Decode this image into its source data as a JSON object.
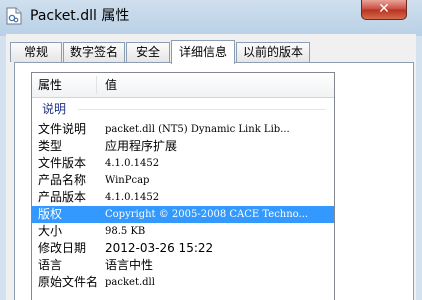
{
  "window": {
    "title": "Packet.dll 属性",
    "close_glyph": "✕"
  },
  "tabs": [
    {
      "label": "常规"
    },
    {
      "label": "数字签名"
    },
    {
      "label": "安全"
    },
    {
      "label": "详细信息",
      "active": true
    },
    {
      "label": "以前的版本"
    }
  ],
  "table": {
    "col_property": "属性",
    "col_value": "值",
    "group": "说明",
    "rows": [
      {
        "k": "文件说明",
        "v": "packet.dll (NT5) Dynamic Link Lib..."
      },
      {
        "k": "类型",
        "v": "应用程序扩展"
      },
      {
        "k": "文件版本",
        "v": "4.1.0.1452"
      },
      {
        "k": "产品名称",
        "v": "WinPcap"
      },
      {
        "k": "产品版本",
        "v": "4.1.0.1452"
      },
      {
        "k": "版权",
        "v": "Copyright © 2005-2008 CACE Techno...",
        "selected": true
      },
      {
        "k": "大小",
        "v": "98.5 KB"
      },
      {
        "k": "修改日期",
        "v": "2012-03-26 15:22"
      },
      {
        "k": "语言",
        "v": "语言中性"
      },
      {
        "k": "原始文件名",
        "v": "packet.dll"
      }
    ]
  },
  "colors": {
    "selection": "#3399ff",
    "group_label": "#1e3287"
  },
  "icons": {
    "app": "dll-file-icon",
    "close": "close-icon"
  }
}
